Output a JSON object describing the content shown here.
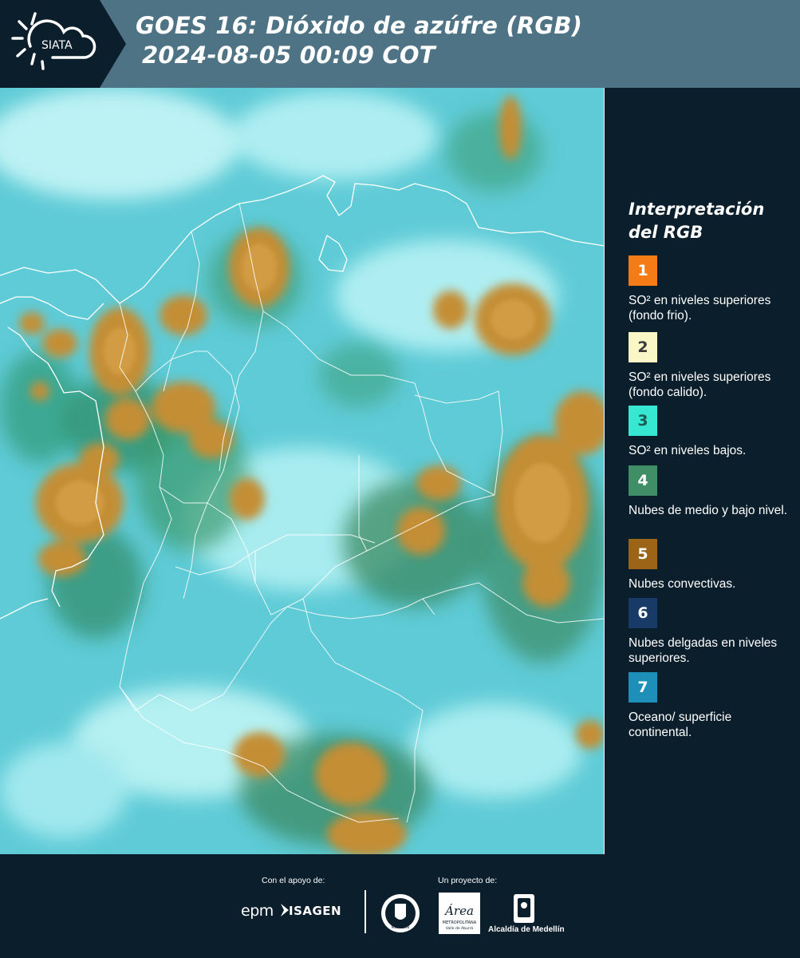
{
  "header": {
    "logo_text": "SIATA",
    "title_line1": "GOES 16: Dióxido de azúfre (RGB)",
    "title_line2": "2024-08-05 00:09 COT",
    "background_color": "#4e7384"
  },
  "legend": {
    "title_line1": "Interpretación",
    "title_line2": "del RGB",
    "items": [
      {
        "number": "1",
        "label": "SO² en niveles superiores (fondo frio).",
        "color": "#f57b16",
        "text_color": "#ffffff"
      },
      {
        "number": "2",
        "label": "SO² en niveles superiores (fondo calido).",
        "color": "#fbf6c5",
        "text_color": "#3a3a3a"
      },
      {
        "number": "3",
        "label": "SO² en niveles bajos.",
        "color": "#36e8d2",
        "text_color": "#1d5a55"
      },
      {
        "number": "4",
        "label": "Nubes de medio y bajo nivel.",
        "color": "#3f8e66",
        "text_color": "#ffffff"
      },
      {
        "number": "5",
        "label": "Nubes convectivas.",
        "color": "#9c6416",
        "text_color": "#ffffff"
      },
      {
        "number": "6",
        "label": "Nubes delgadas en niveles superiores.",
        "color": "#173a66",
        "text_color": "#ffffff"
      },
      {
        "number": "7",
        "label": "Oceano/ superficie continental.",
        "color": "#1e8fb8",
        "text_color": "#ffffff"
      }
    ]
  },
  "footer": {
    "support_label": "Con el apoyo de:",
    "project_label": "Un proyecto de:",
    "sponsor_epm": "epm",
    "sponsor_isagen": "ISAGEN",
    "partner_medellin_seal": "MEDELLÍN",
    "partner_area": "Área",
    "partner_area_sub": "METROPOLITANA",
    "partner_area_sub2": "Valle de Aburrá",
    "partner_alcaldia": "Alcaldía de Medellín"
  }
}
